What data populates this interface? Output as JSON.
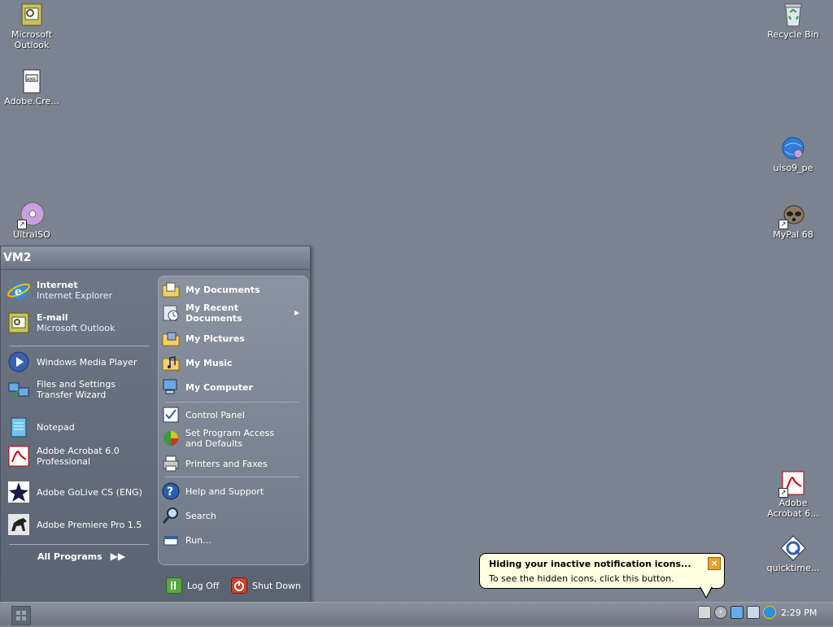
{
  "desktop": {
    "icons": [
      {
        "label": "Microsoft\nOutlook",
        "icon": "outlook-icon"
      },
      {
        "label": "Adobe.Cre...",
        "icon": "document-icon"
      },
      {
        "label": "UltraISO",
        "icon": "disc-icon"
      },
      {
        "label": "Recycle Bin",
        "icon": "recycle-bin-icon"
      },
      {
        "label": "uiso9_pe",
        "icon": "globe-icon"
      },
      {
        "label": "MyPal 68",
        "icon": "raccoon-icon"
      },
      {
        "label": "Adobe\nAcrobat 6...",
        "icon": "acrobat-icon"
      },
      {
        "label": "quicktime...",
        "icon": "quicktime-icon"
      }
    ]
  },
  "start_menu": {
    "user": "VM2",
    "pinned": [
      {
        "title": "Internet",
        "subtitle": "Internet Explorer",
        "icon": "internet-explorer-icon"
      },
      {
        "title": "E-mail",
        "subtitle": "Microsoft Outlook",
        "icon": "outlook-icon"
      }
    ],
    "recent": [
      {
        "label": "Windows Media Player",
        "icon": "media-player-icon"
      },
      {
        "label": "Files and Settings\nTransfer Wizard",
        "icon": "transfer-wizard-icon"
      },
      {
        "label": "Notepad",
        "icon": "notepad-icon"
      },
      {
        "label": "Adobe Acrobat 6.0\nProfessional",
        "icon": "acrobat-icon"
      },
      {
        "label": "Adobe GoLive CS (ENG)",
        "icon": "golive-icon"
      },
      {
        "label": "Adobe Premiere Pro 1.5",
        "icon": "premiere-icon"
      }
    ],
    "all_programs": "All Programs",
    "right": [
      {
        "label": "My Documents",
        "icon": "folder-documents-icon",
        "bold": true
      },
      {
        "label": "My Recent\nDocuments",
        "icon": "recent-documents-icon",
        "bold": true,
        "submenu": true
      },
      {
        "label": "My Pictures",
        "icon": "folder-pictures-icon",
        "bold": true
      },
      {
        "label": "My Music",
        "icon": "folder-music-icon",
        "bold": true
      },
      {
        "label": "My Computer",
        "icon": "computer-icon",
        "bold": true
      },
      {
        "label": "Control Panel",
        "icon": "control-panel-icon",
        "bold": false
      },
      {
        "label": "Set Program Access\nand Defaults",
        "icon": "program-access-icon",
        "bold": false
      },
      {
        "label": "Printers and Faxes",
        "icon": "printer-icon",
        "bold": false
      },
      {
        "label": "Help and Support",
        "icon": "help-icon",
        "bold": false
      },
      {
        "label": "Search",
        "icon": "search-icon",
        "bold": false
      },
      {
        "label": "Run...",
        "icon": "run-icon",
        "bold": false
      }
    ],
    "log_off": "Log Off",
    "shut_down": "Shut Down"
  },
  "balloon": {
    "title": "Hiding your inactive notification icons...",
    "body": "To see the hidden icons, click this button.",
    "close": "×"
  },
  "taskbar": {
    "clock": "2:29 PM"
  },
  "colors": {
    "desktop": "#7b8290",
    "balloon": "#ffffe1"
  }
}
